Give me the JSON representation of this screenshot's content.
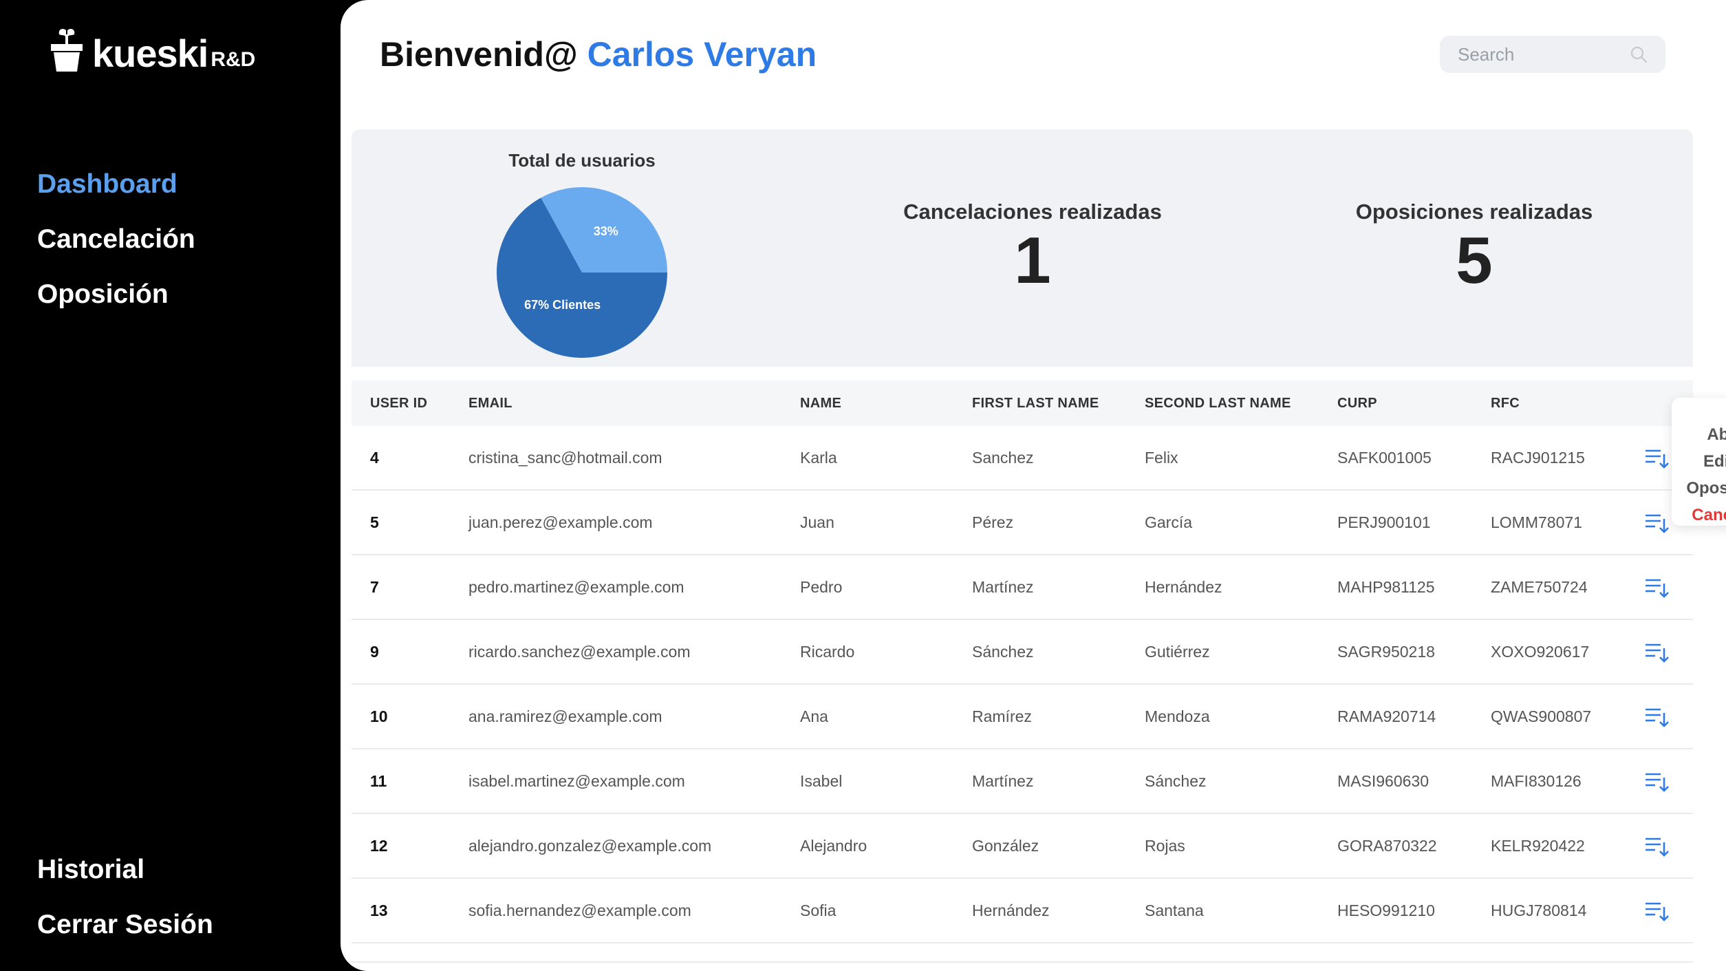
{
  "brand": {
    "name": "kueski",
    "suffix": "R&D"
  },
  "sidebar": {
    "items_top": [
      {
        "label": "Dashboard",
        "active": true
      },
      {
        "label": "Cancelación",
        "active": false
      },
      {
        "label": "Oposición",
        "active": false
      }
    ],
    "items_bottom": [
      {
        "label": "Historial"
      },
      {
        "label": "Cerrar Sesión"
      }
    ]
  },
  "header": {
    "greeting": "Bienvenid@",
    "user_name": "Carlos Veryan",
    "search_placeholder": "Search"
  },
  "stats": {
    "pie_title": "Total de usuarios",
    "pie_slices": [
      {
        "label": "33%",
        "value": 33,
        "color": "#6aaaef"
      },
      {
        "label": "67% Clientes",
        "value": 67,
        "color": "#2c6cb7"
      }
    ],
    "cancelaciones_label": "Cancelaciones realizadas",
    "cancelaciones_value": "1",
    "oposiciones_label": "Oposiciones realizadas",
    "oposiciones_value": "5"
  },
  "table": {
    "headers": [
      "USER ID",
      "EMAIL",
      "NAME",
      "FIRST LAST NAME",
      "SECOND LAST NAME",
      "CURP",
      "RFC"
    ],
    "rows": [
      [
        "4",
        "cristina_sanc@hotmail.com",
        "Karla",
        "Sanchez",
        "Felix",
        "SAFK001005",
        "RACJ901215"
      ],
      [
        "5",
        "juan.perez@example.com",
        "Juan",
        "Pérez",
        "García",
        "PERJ900101",
        "LOMM78071"
      ],
      [
        "7",
        "pedro.martinez@example.com",
        "Pedro",
        "Martínez",
        "Hernández",
        "MAHP981125",
        "ZAME750724"
      ],
      [
        "9",
        "ricardo.sanchez@example.com",
        "Ricardo",
        "Sánchez",
        "Gutiérrez",
        "SAGR950218",
        "XOXO920617"
      ],
      [
        "10",
        "ana.ramirez@example.com",
        "Ana",
        "Ramírez",
        "Mendoza",
        "RAMA920714",
        "QWAS900807"
      ],
      [
        "11",
        "isabel.martinez@example.com",
        "Isabel",
        "Martínez",
        "Sánchez",
        "MASI960630",
        "MAFI830126"
      ],
      [
        "12",
        "alejandro.gonzalez@example.com",
        "Alejandro",
        "González",
        "Rojas",
        "GORA870322",
        "KELR920422"
      ],
      [
        "13",
        "sofia.hernandez@example.com",
        "Sofia",
        "Hernández",
        "Santana",
        "HESO991210",
        "HUGJ780814"
      ]
    ]
  },
  "popup_menu": {
    "items": [
      "Abrir",
      "Editar",
      "Oposición",
      "Cancelar"
    ]
  },
  "colors": {
    "accent": "#2f7be6",
    "nav_active": "#5aa0ee",
    "danger": "#e53935"
  },
  "icons": {
    "row_action": "sort-list-icon",
    "search": "search-icon",
    "close": "close-icon",
    "logo": "plant-pot-icon"
  }
}
